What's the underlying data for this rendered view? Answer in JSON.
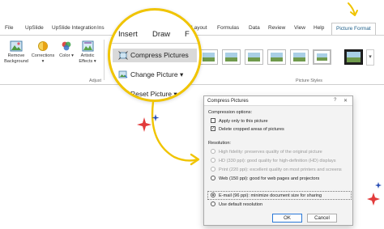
{
  "ribbon": {
    "tabs": [
      "File",
      "UpSlide",
      "UpSlide Integration",
      "Ins",
      "Layout",
      "Formulas",
      "Data",
      "Review",
      "View",
      "Help"
    ],
    "context_tab": "Picture Format",
    "buttons": {
      "remove_background": "Remove Background",
      "corrections": "Corrections",
      "color": "Color",
      "artistic_effects": "Artistic Effects"
    },
    "groups": {
      "adjust": "Adjust",
      "picture_styles": "Picture Styles"
    },
    "gallery_more": "▾"
  },
  "zoom": {
    "tabs": [
      "Insert",
      "Draw"
    ],
    "tab_fragment": "F",
    "commands": [
      "Compress Pictures",
      "Change Picture",
      "Reset Picture"
    ],
    "dropdown_glyph": "▾"
  },
  "dialog": {
    "title": "Compress Pictures",
    "help": "?",
    "close": "✕",
    "compression_options_label": "Compression options:",
    "apply_only": {
      "label": "Apply only to this picture",
      "checked": false
    },
    "delete_cropped": {
      "label": "Delete cropped areas of pictures",
      "checked": true
    },
    "resolution_label": "Resolution:",
    "resolutions": [
      {
        "label": "High fidelity: preserves quality of the original picture",
        "enabled": false,
        "selected": false
      },
      {
        "label": "HD (330 ppi): good quality for high-definition (HD) displays",
        "enabled": false,
        "selected": false
      },
      {
        "label": "Print (220 ppi): excellent quality on most printers and screens",
        "enabled": false,
        "selected": false
      },
      {
        "label": "Web (150 ppi): good for web pages and projectors",
        "enabled": true,
        "selected": false
      },
      {
        "label": "E-mail (96 ppi): minimize document size for sharing",
        "enabled": true,
        "selected": true
      },
      {
        "label": "Use default resolution",
        "enabled": true,
        "selected": false
      }
    ],
    "ok": "OK",
    "cancel": "Cancel"
  },
  "colors": {
    "accent_yellow": "#f0c400",
    "ribbon_active_tab": "#1e5f8a",
    "sparkle_red": "#e23b3b",
    "sparkle_blue": "#2a4fb5"
  }
}
